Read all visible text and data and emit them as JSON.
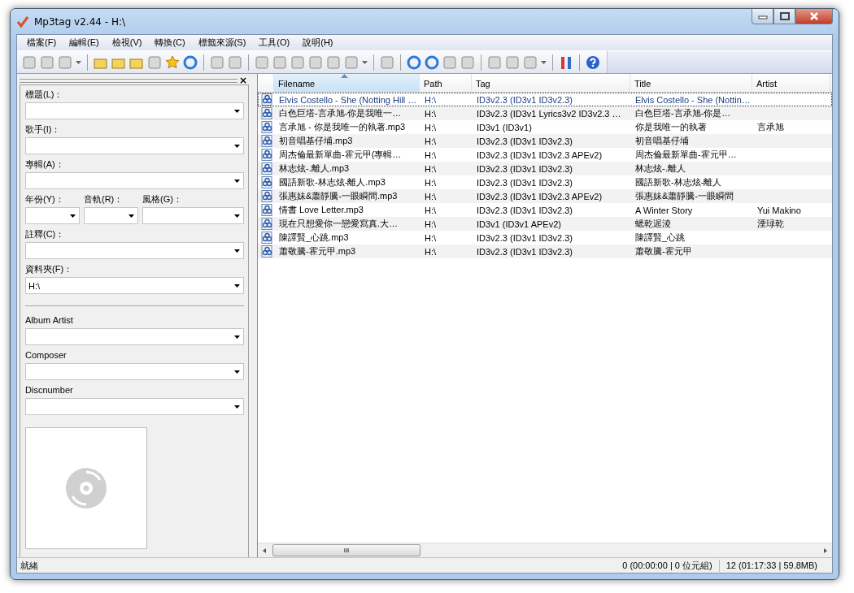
{
  "window": {
    "title": "Mp3tag v2.44  -  H:\\"
  },
  "menu": [
    "檔案(F)",
    "編輯(E)",
    "檢視(V)",
    "轉換(C)",
    "標籤來源(S)",
    "工具(O)",
    "說明(H)"
  ],
  "tag_panel": {
    "close": "×",
    "fields": [
      {
        "kind": "combo",
        "label": "標題(L)："
      },
      {
        "kind": "combo",
        "label": "歌手(I)："
      },
      {
        "kind": "combo",
        "label": "專輯(A)："
      },
      {
        "kind": "row",
        "items": [
          {
            "label": "年份(Y)："
          },
          {
            "label": "音軌(R)："
          },
          {
            "label": "風格(G)："
          }
        ]
      },
      {
        "kind": "combo",
        "label": "註釋(C)："
      },
      {
        "kind": "combo",
        "label": "資料夾(F)：",
        "value": "H:\\"
      }
    ],
    "extra_fields": [
      {
        "label": "Album Artist"
      },
      {
        "label": "Composer"
      },
      {
        "label": "Discnumber"
      }
    ]
  },
  "table": {
    "columns": [
      {
        "label": "Filename",
        "sorted": true
      },
      {
        "label": "Path",
        "sorted": false
      },
      {
        "label": "Tag",
        "sorted": false
      },
      {
        "label": "Title",
        "sorted": false
      },
      {
        "label": "Artist",
        "sorted": false
      }
    ],
    "rows": [
      {
        "selected": true,
        "cells": [
          "Elvis Costello - She (Notting Hill …",
          "H:\\",
          "ID3v2.3 (ID3v1 ID3v2.3)",
          "Elvis Costello - She (Nottin…",
          ""
        ]
      },
      {
        "selected": false,
        "cells": [
          "白色巨塔-言承旭-你是我唯一…",
          "H:\\",
          "ID3v2.3 (ID3v1 Lyrics3v2 ID3v2.3 …",
          "白色巨塔-言承旭-你是…",
          ""
        ]
      },
      {
        "selected": false,
        "cells": [
          "言承旭 - 你是我唯一的執著.mp3",
          "H:\\",
          "ID3v1 (ID3v1)",
          "你是我唯一的執著",
          "言承旭"
        ]
      },
      {
        "selected": false,
        "cells": [
          "初音唱基仔埔.mp3",
          "H:\\",
          "ID3v2.3 (ID3v1 ID3v2.3)",
          "初音唱基仔埔",
          ""
        ]
      },
      {
        "selected": false,
        "cells": [
          "周杰倫最新單曲-霍元甲(專輯…",
          "H:\\",
          "ID3v2.3 (ID3v1 ID3v2.3 APEv2)",
          "周杰倫最新單曲-霍元甲…",
          ""
        ]
      },
      {
        "selected": false,
        "cells": [
          "林志炫-.離人.mp3",
          "H:\\",
          "ID3v2.3 (ID3v1 ID3v2.3)",
          "林志炫-.離人",
          ""
        ]
      },
      {
        "selected": false,
        "cells": [
          "國語新歌-林志炫-離人.mp3",
          "H:\\",
          "ID3v2.3 (ID3v1 ID3v2.3)",
          "國語新歌-林志炫-離人",
          ""
        ]
      },
      {
        "selected": false,
        "cells": [
          "張惠妹&蕭靜騰-一眼瞬間.mp3",
          "H:\\",
          "ID3v2.3 (ID3v1 ID3v2.3 APEv2)",
          "張惠妹&蕭靜騰-一眼瞬間",
          ""
        ]
      },
      {
        "selected": false,
        "cells": [
          "情書 Love Letter.mp3",
          "H:\\",
          "ID3v2.3 (ID3v1 ID3v2.3)",
          "A Winter Story",
          "Yui Makino"
        ]
      },
      {
        "selected": false,
        "cells": [
          "現在只想愛你一戀愛寫真.大…",
          "H:\\",
          "ID3v1 (ID3v1 APEv2)",
          "蟋乾迡淩",
          "湮琭乾"
        ]
      },
      {
        "selected": false,
        "cells": [
          "陳譯賢_心跳.mp3",
          "H:\\",
          "ID3v2.3 (ID3v1 ID3v2.3)",
          "陳譯賢_心跳",
          ""
        ]
      },
      {
        "selected": false,
        "cells": [
          "蕭敬騰-霍元甲.mp3",
          "H:\\",
          "ID3v2.3 (ID3v1 ID3v2.3)",
          "蕭敬騰-霍元甲",
          ""
        ]
      }
    ]
  },
  "hscroll_grip": "III",
  "status_bar": {
    "left": "就緒",
    "selected": "0 (00:00:00 | 0 位元組)",
    "total": "12 (01:17:33 | 59.8MB)"
  }
}
